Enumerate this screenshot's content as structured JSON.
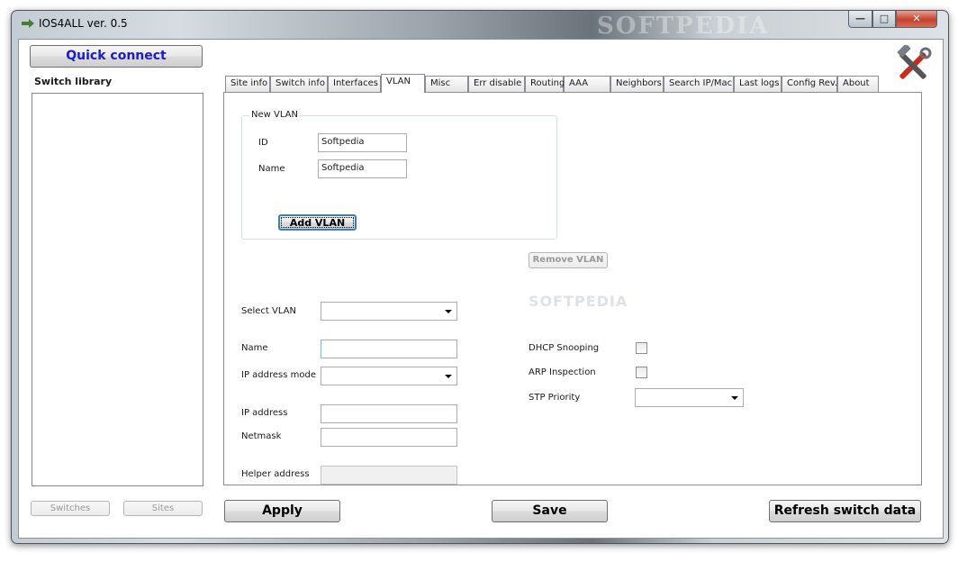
{
  "window": {
    "title": "IOS4ALL ver. 0.5",
    "watermark": "SOFTPEDIA"
  },
  "title_buttons": {
    "minimize": "—",
    "maximize": "□",
    "close": "✕"
  },
  "sidebar": {
    "quick_connect": "Quick connect",
    "library_label": "Switch library",
    "switches_button": "Switches",
    "sites_button": "Sites"
  },
  "tabs": [
    "Site info",
    "Switch info",
    "Interfaces",
    "VLAN",
    "Misc",
    "Err disable",
    "Routing",
    "AAA",
    "Neighbors",
    "Search IP/Mac",
    "Last logs",
    "Config Rev.",
    "About"
  ],
  "active_tab": "VLAN",
  "new_vlan": {
    "legend": "New VLAN",
    "id_label": "ID",
    "id_value": "Softpedia",
    "name_label": "Name",
    "name_value": "Softpedia",
    "add_button": "Add VLAN"
  },
  "vlan_edit": {
    "select_label": "Select VLAN",
    "select_value": "",
    "remove_button": "Remove VLAN",
    "name_label": "Name",
    "name_value": "",
    "ip_mode_label": "IP address mode",
    "ip_mode_value": "",
    "ip_label": "IP address",
    "ip_value": "",
    "netmask_label": "Netmask",
    "netmask_value": "",
    "helper_label": "Helper address",
    "helper_value": "",
    "dhcp_label": "DHCP Snooping",
    "dhcp_checked": false,
    "arp_label": "ARP Inspection",
    "arp_checked": false,
    "stp_label": "STP Priority",
    "stp_value": ""
  },
  "footer": {
    "apply": "Apply",
    "save": "Save",
    "refresh": "Refresh switch data"
  },
  "icons": {
    "app": "app-icon",
    "tools": "tools-icon",
    "dropdown": "chevron-down-icon"
  },
  "colors": {
    "quick_connect_text": "#1a1ad0",
    "close_button": "#c4422d"
  }
}
